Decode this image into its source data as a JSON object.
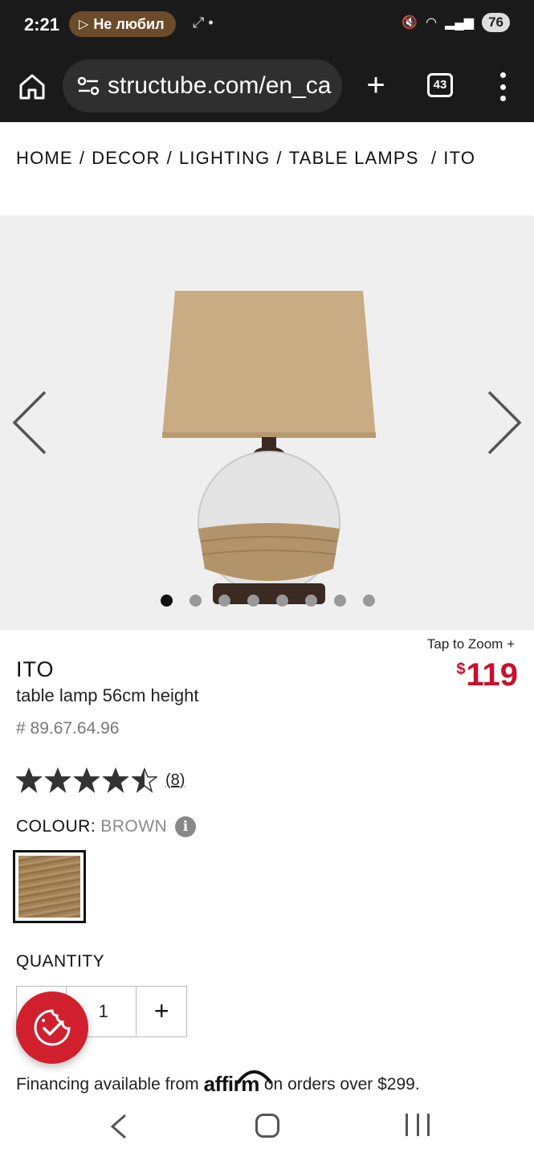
{
  "status_bar": {
    "time": "2:21",
    "media_pill": "Не любил",
    "battery": "76"
  },
  "browser": {
    "url": "structube.com/en_ca",
    "tab_count": "43"
  },
  "breadcrumb": [
    "HOME",
    "DECOR",
    "LIGHTING",
    "TABLE LAMPS",
    "ITO"
  ],
  "gallery": {
    "slide_count": 8,
    "active_index": 0
  },
  "product": {
    "zoom_label": "Tap to Zoom +",
    "price_currency": "$",
    "price_value": "119",
    "name": "ITO",
    "description": "table lamp 56cm height",
    "sku": "# 89.67.64.96",
    "rating": 4.5,
    "review_count": "(8)",
    "colour_label": "COLOUR:",
    "colour_value": "BROWN",
    "quantity_label": "QUANTITY",
    "quantity_value": "1",
    "financing_before": "Financing available from",
    "financing_brand": "affirm",
    "financing_after": "on orders over $299."
  },
  "colors": {
    "price": "#c8102e",
    "fab": "#d0202e",
    "chrome": "#1a1a1a"
  },
  "icons": {
    "home": "home-icon",
    "tune": "site-settings-icon",
    "menu": "more-vertical-icon",
    "fab": "cookie-consent-icon"
  }
}
